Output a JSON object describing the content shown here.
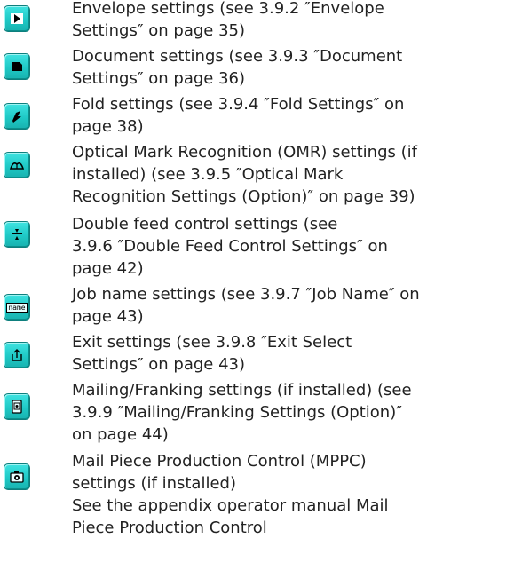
{
  "items": [
    {
      "icon": "envelope-icon",
      "lines": [
        "Envelope settings (see 3.9.2 ″Envelope",
        "Settings″ on page 35)"
      ]
    },
    {
      "icon": "document-icon",
      "lines": [
        "Document settings (see 3.9.3 ″Document",
        "Settings″ on page 36)"
      ]
    },
    {
      "icon": "fold-icon",
      "lines": [
        "Fold settings (see 3.9.4 ″Fold Settings″ on",
        "page 38)"
      ]
    },
    {
      "icon": "omr-icon",
      "lines": [
        "Optical Mark Recognition (OMR) settings (if",
        "installed) (see 3.9.5 ″Optical Mark",
        "Recognition Settings (Option)″ on page 39)"
      ]
    },
    {
      "icon": "double-feed-icon",
      "lines": [
        "Double feed control settings (see",
        "3.9.6 ″Double Feed Control Settings″ on",
        "page 42)"
      ]
    },
    {
      "icon": "job-name-icon",
      "icon_text": "name",
      "lines": [
        "Job name settings (see 3.9.7 ″Job Name″ on",
        "page 43)"
      ]
    },
    {
      "icon": "exit-icon",
      "lines": [
        "Exit settings (see 3.9.8 ″Exit Select",
        "Settings″ on page 43)"
      ]
    },
    {
      "icon": "franking-icon",
      "lines": [
        "Mailing/Franking settings (if installed) (see",
        "3.9.9 ″Mailing/Franking Settings (Option)″",
        "on page 44)"
      ]
    },
    {
      "icon": "camera-icon",
      "lines": [
        "Mail Piece Production Control (MPPC)",
        "settings (if installed)",
        "See the appendix operator manual Mail",
        "Piece Production Control"
      ]
    }
  ]
}
